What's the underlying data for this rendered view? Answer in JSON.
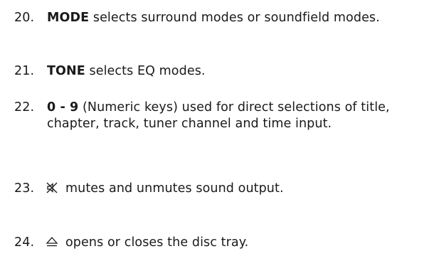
{
  "items": [
    {
      "number": "20.",
      "keyword": "MODE",
      "text": " selects surround modes or soundfield modes."
    },
    {
      "number": "21.",
      "keyword": "TONE",
      "text": " selects EQ modes."
    },
    {
      "number": "22.",
      "keyword": "0 - 9",
      "text": " (Numeric keys) used for direct selections of title, chapter, track, tuner channel and time input."
    },
    {
      "number": "23.",
      "icon": "mute-icon",
      "text": "mutes and unmutes sound output."
    },
    {
      "number": "24.",
      "icon": "eject-icon",
      "text": "opens or closes the disc tray."
    }
  ]
}
